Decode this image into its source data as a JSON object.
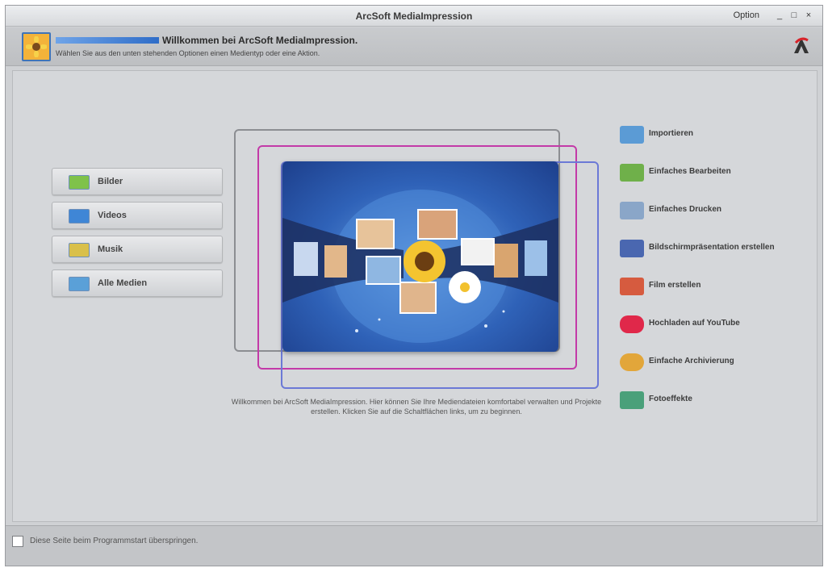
{
  "window": {
    "title": "ArcSoft MediaImpression",
    "options_label": "Option",
    "controls": {
      "minimize": "_",
      "maximize": "□",
      "close": "×"
    }
  },
  "header": {
    "title": "Willkommen bei ArcSoft MediaImpression.",
    "subtitle": "Wählen Sie aus den unten stehenden Optionen einen Medientyp oder eine Aktion.",
    "icon": "sunflower-icon",
    "brand_icon": "arcsoft-logo-icon"
  },
  "media_types": [
    {
      "label": "Bilder",
      "icon": "images-folder-icon",
      "color": "#7fc24a"
    },
    {
      "label": "Videos",
      "icon": "videos-folder-icon",
      "color": "#3f86d6"
    },
    {
      "label": "Musik",
      "icon": "music-folder-icon",
      "color": "#d9c04a"
    },
    {
      "label": "Alle Medien",
      "icon": "all-media-folder-icon",
      "color": "#5aa0d8"
    }
  ],
  "actions": [
    {
      "label": "Importieren",
      "icon": "import-icon",
      "color": "#5b9bd5"
    },
    {
      "label": "Einfaches Bearbeiten",
      "icon": "edit-icon",
      "color": "#6fb04a"
    },
    {
      "label": "Einfaches Drucken",
      "icon": "print-icon",
      "color": "#8aa6c8"
    },
    {
      "label": "Bildschirmpräsentation erstellen",
      "icon": "slideshow-icon",
      "color": "#4a67b0"
    },
    {
      "label": "Film erstellen",
      "icon": "film-icon",
      "color": "#d65b3f"
    },
    {
      "label": "Hochladen auf YouTube",
      "icon": "youtube-icon",
      "color": "#e0284a"
    },
    {
      "label": "Einfache Archivierung",
      "icon": "archive-icon",
      "color": "#e2a63a"
    },
    {
      "label": "Fotoeffekte",
      "icon": "photo-effects-icon",
      "color": "#4aa07a"
    }
  ],
  "description": "Willkommen bei ArcSoft MediaImpression. Hier können Sie Ihre Mediendateien komfortabel verwalten und Projekte erstellen. Klicken Sie auf die Schaltflächen links, um zu beginnen.",
  "footer": {
    "checkbox_label": "Diese Seite beim Programmstart überspringen.",
    "checked": false
  },
  "colors": {
    "frame_gray": "#8c8e92",
    "frame_magenta": "#c33aa8",
    "frame_blue": "#6b79d6",
    "hero_blue": "#2f62b8"
  }
}
